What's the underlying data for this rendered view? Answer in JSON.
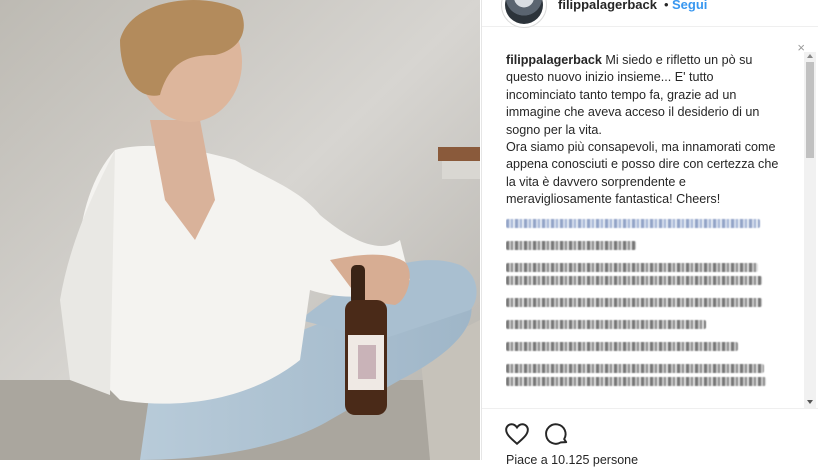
{
  "header": {
    "username": "filippalagerback",
    "separator": "•",
    "follow_label": "Segui"
  },
  "caption": {
    "username": "filippalagerback",
    "text": "Mi siedo e rifletto un pò su questo nuovo inizio insieme... E' tutto incominciato tanto tempo fa, grazie ad un immagine che aveva acceso il desiderio di un sogno per la vita.",
    "text2": "Ora siamo più consapevoli, ma innamorati come appena conosciuti e posso dire con certezza che la vita è davvero sorprendente e meravigliosamente fantastica! Cheers!"
  },
  "close_glyph": "×",
  "likes": {
    "text": "Piace a 10.125 persone"
  },
  "icons": {
    "like": "heart-icon",
    "comment": "comment-icon"
  },
  "colors": {
    "link_blue": "#3897f0",
    "text": "#262626"
  }
}
